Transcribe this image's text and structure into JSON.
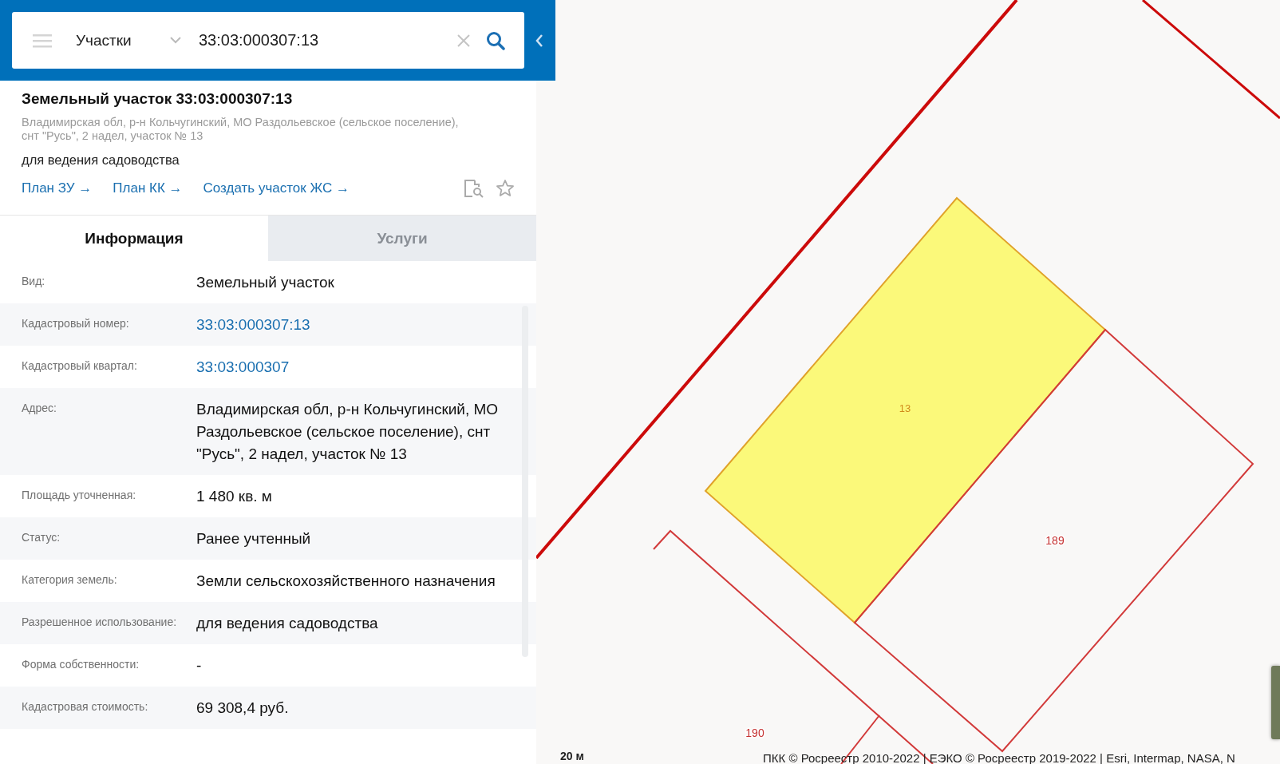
{
  "search": {
    "category": "Участки",
    "value": "33:03:000307:13"
  },
  "card": {
    "title": "Земельный участок 33:03:000307:13",
    "address": "Владимирская обл, р-н Кольчугинский, МО Раздольевское (сельское поселение), снт \"Русь\", 2 надел, участок № 13",
    "purpose": "для ведения садоводства",
    "links": [
      "План ЗУ →",
      "План КК →",
      "Создать участок ЖС →"
    ]
  },
  "tabs": [
    {
      "label": "Информация",
      "selected": true
    },
    {
      "label": "Услуги",
      "selected": false
    }
  ],
  "rows": [
    {
      "label": "Вид:",
      "value": "Земельный участок",
      "kind": "text"
    },
    {
      "label": "Кадастровый номер:",
      "value": "33:03:000307:13",
      "kind": "link"
    },
    {
      "label": "Кадастровый квартал:",
      "value": "33:03:000307",
      "kind": "link"
    },
    {
      "label": "Адрес:",
      "value": "Владимирская обл, р-н Кольчугинский, МО Раздольевское (сельское поселение), снт \"Русь\", 2 надел, участок № 13",
      "kind": "text"
    },
    {
      "label": "Площадь уточненная:",
      "value": "1 480 кв. м",
      "kind": "text"
    },
    {
      "label": "Статус:",
      "value": "Ранее учтенный",
      "kind": "text"
    },
    {
      "label": "Категория земель:",
      "value": "Земли сельскохозяйственного назначения",
      "kind": "text"
    },
    {
      "label": "Разрешенное использование:",
      "value": "для ведения садоводства",
      "kind": "text"
    },
    {
      "label": "Форма собственности:",
      "value": "-",
      "kind": "text"
    },
    {
      "label": "Кадастровая стоимость:",
      "value": "69 308,4 руб.",
      "kind": "text"
    }
  ],
  "map": {
    "parcels": [
      {
        "label": "13",
        "selected": true
      },
      {
        "label": "189",
        "selected": false
      },
      {
        "label": "190",
        "selected": false
      }
    ],
    "scale": "20 м",
    "attribution": "ПКК © Росреестр 2010-2022 | ЕЭКО © Росреестр 2019-2022 | Esri, Intermap, NASA, N"
  }
}
